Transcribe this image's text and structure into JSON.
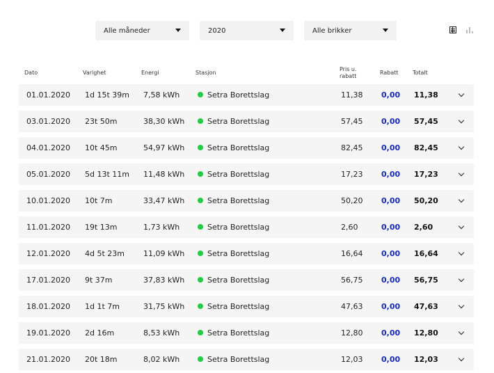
{
  "filters": {
    "month": "Alle måneder",
    "year": "2020",
    "chips": "Alle brikker"
  },
  "view_icons": [
    "table-view-icon",
    "chart-view-icon"
  ],
  "columns": {
    "dato": "Dato",
    "varighet": "Varighet",
    "energi": "Energi",
    "stasjon": "Stasjon",
    "pris_line1": "Pris u.",
    "pris_line2": "rabatt",
    "rabatt": "Rabatt",
    "totalt": "Totalt"
  },
  "colors": {
    "status_dot": "#22cc44",
    "rabatt": "#1a2bb0",
    "row_bg": "#f5f5f5"
  },
  "rows": [
    {
      "dato": "01.01.2020",
      "varighet": "1d 15t 39m",
      "energi": "7,58 kWh",
      "stasjon": "Setra Borettslag",
      "pris": "11,38",
      "rabatt": "0,00",
      "totalt": "11,38"
    },
    {
      "dato": "03.01.2020",
      "varighet": "23t 50m",
      "energi": "38,30 kWh",
      "stasjon": "Setra Borettslag",
      "pris": "57,45",
      "rabatt": "0,00",
      "totalt": "57,45"
    },
    {
      "dato": "04.01.2020",
      "varighet": "10t 45m",
      "energi": "54,97 kWh",
      "stasjon": "Setra Borettslag",
      "pris": "82,45",
      "rabatt": "0,00",
      "totalt": "82,45"
    },
    {
      "dato": "05.01.2020",
      "varighet": "5d 13t 11m",
      "energi": "11,48 kWh",
      "stasjon": "Setra Borettslag",
      "pris": "17,23",
      "rabatt": "0,00",
      "totalt": "17,23"
    },
    {
      "dato": "10.01.2020",
      "varighet": "10t 7m",
      "energi": "33,47 kWh",
      "stasjon": "Setra Borettslag",
      "pris": "50,20",
      "rabatt": "0,00",
      "totalt": "50,20"
    },
    {
      "dato": "11.01.2020",
      "varighet": "19t 13m",
      "energi": "1,73 kWh",
      "stasjon": "Setra Borettslag",
      "pris": "2,60",
      "rabatt": "0,00",
      "totalt": "2,60"
    },
    {
      "dato": "12.01.2020",
      "varighet": "4d 5t 23m",
      "energi": "11,09 kWh",
      "stasjon": "Setra Borettslag",
      "pris": "16,64",
      "rabatt": "0,00",
      "totalt": "16,64"
    },
    {
      "dato": "17.01.2020",
      "varighet": "9t 37m",
      "energi": "37,83 kWh",
      "stasjon": "Setra Borettslag",
      "pris": "56,75",
      "rabatt": "0,00",
      "totalt": "56,75"
    },
    {
      "dato": "18.01.2020",
      "varighet": "1d 1t 7m",
      "energi": "31,75 kWh",
      "stasjon": "Setra Borettslag",
      "pris": "47,63",
      "rabatt": "0,00",
      "totalt": "47,63"
    },
    {
      "dato": "19.01.2020",
      "varighet": "2d 16m",
      "energi": "8,53 kWh",
      "stasjon": "Setra Borettslag",
      "pris": "12,80",
      "rabatt": "0,00",
      "totalt": "12,80"
    },
    {
      "dato": "21.01.2020",
      "varighet": "20t 18m",
      "energi": "8,02 kWh",
      "stasjon": "Setra Borettslag",
      "pris": "12,03",
      "rabatt": "0,00",
      "totalt": "12,03"
    }
  ]
}
